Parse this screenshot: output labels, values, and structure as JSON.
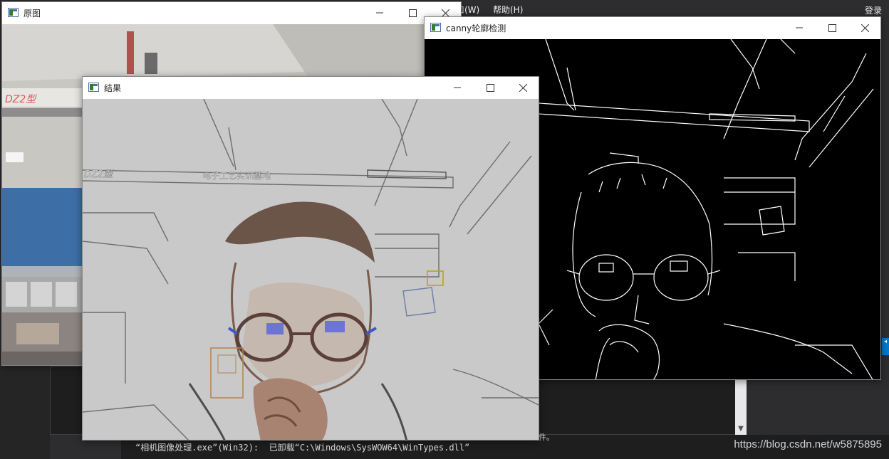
{
  "ide": {
    "menu_window": "口(W)",
    "menu_help": "帮助(H)",
    "login": "登录",
    "output_line": "“相机图像处理.exe”(Win32):  已卸载“C:\\Windows\\SysWOW64\\WinTypes.dll”",
    "output_tail": "件。",
    "watermark": "https://blog.csdn.net/w5875895"
  },
  "windows": {
    "original": {
      "title": "原图",
      "sign_text": "DZ2型"
    },
    "canny": {
      "title": "canny轮廓检测"
    },
    "result": {
      "title": "结果",
      "sign_text": "DZ2型",
      "banner_text": "电子工艺实训基地"
    }
  },
  "icons": {
    "window_icon": "app-window-icon",
    "minimize": "minimize-icon",
    "maximize": "maximize-icon",
    "close": "close-icon"
  },
  "colors": {
    "ide_bg": "#2d2d30",
    "canny_bg": "#000000",
    "result_bg": "#c9c9c9",
    "accent": "#007acc"
  }
}
